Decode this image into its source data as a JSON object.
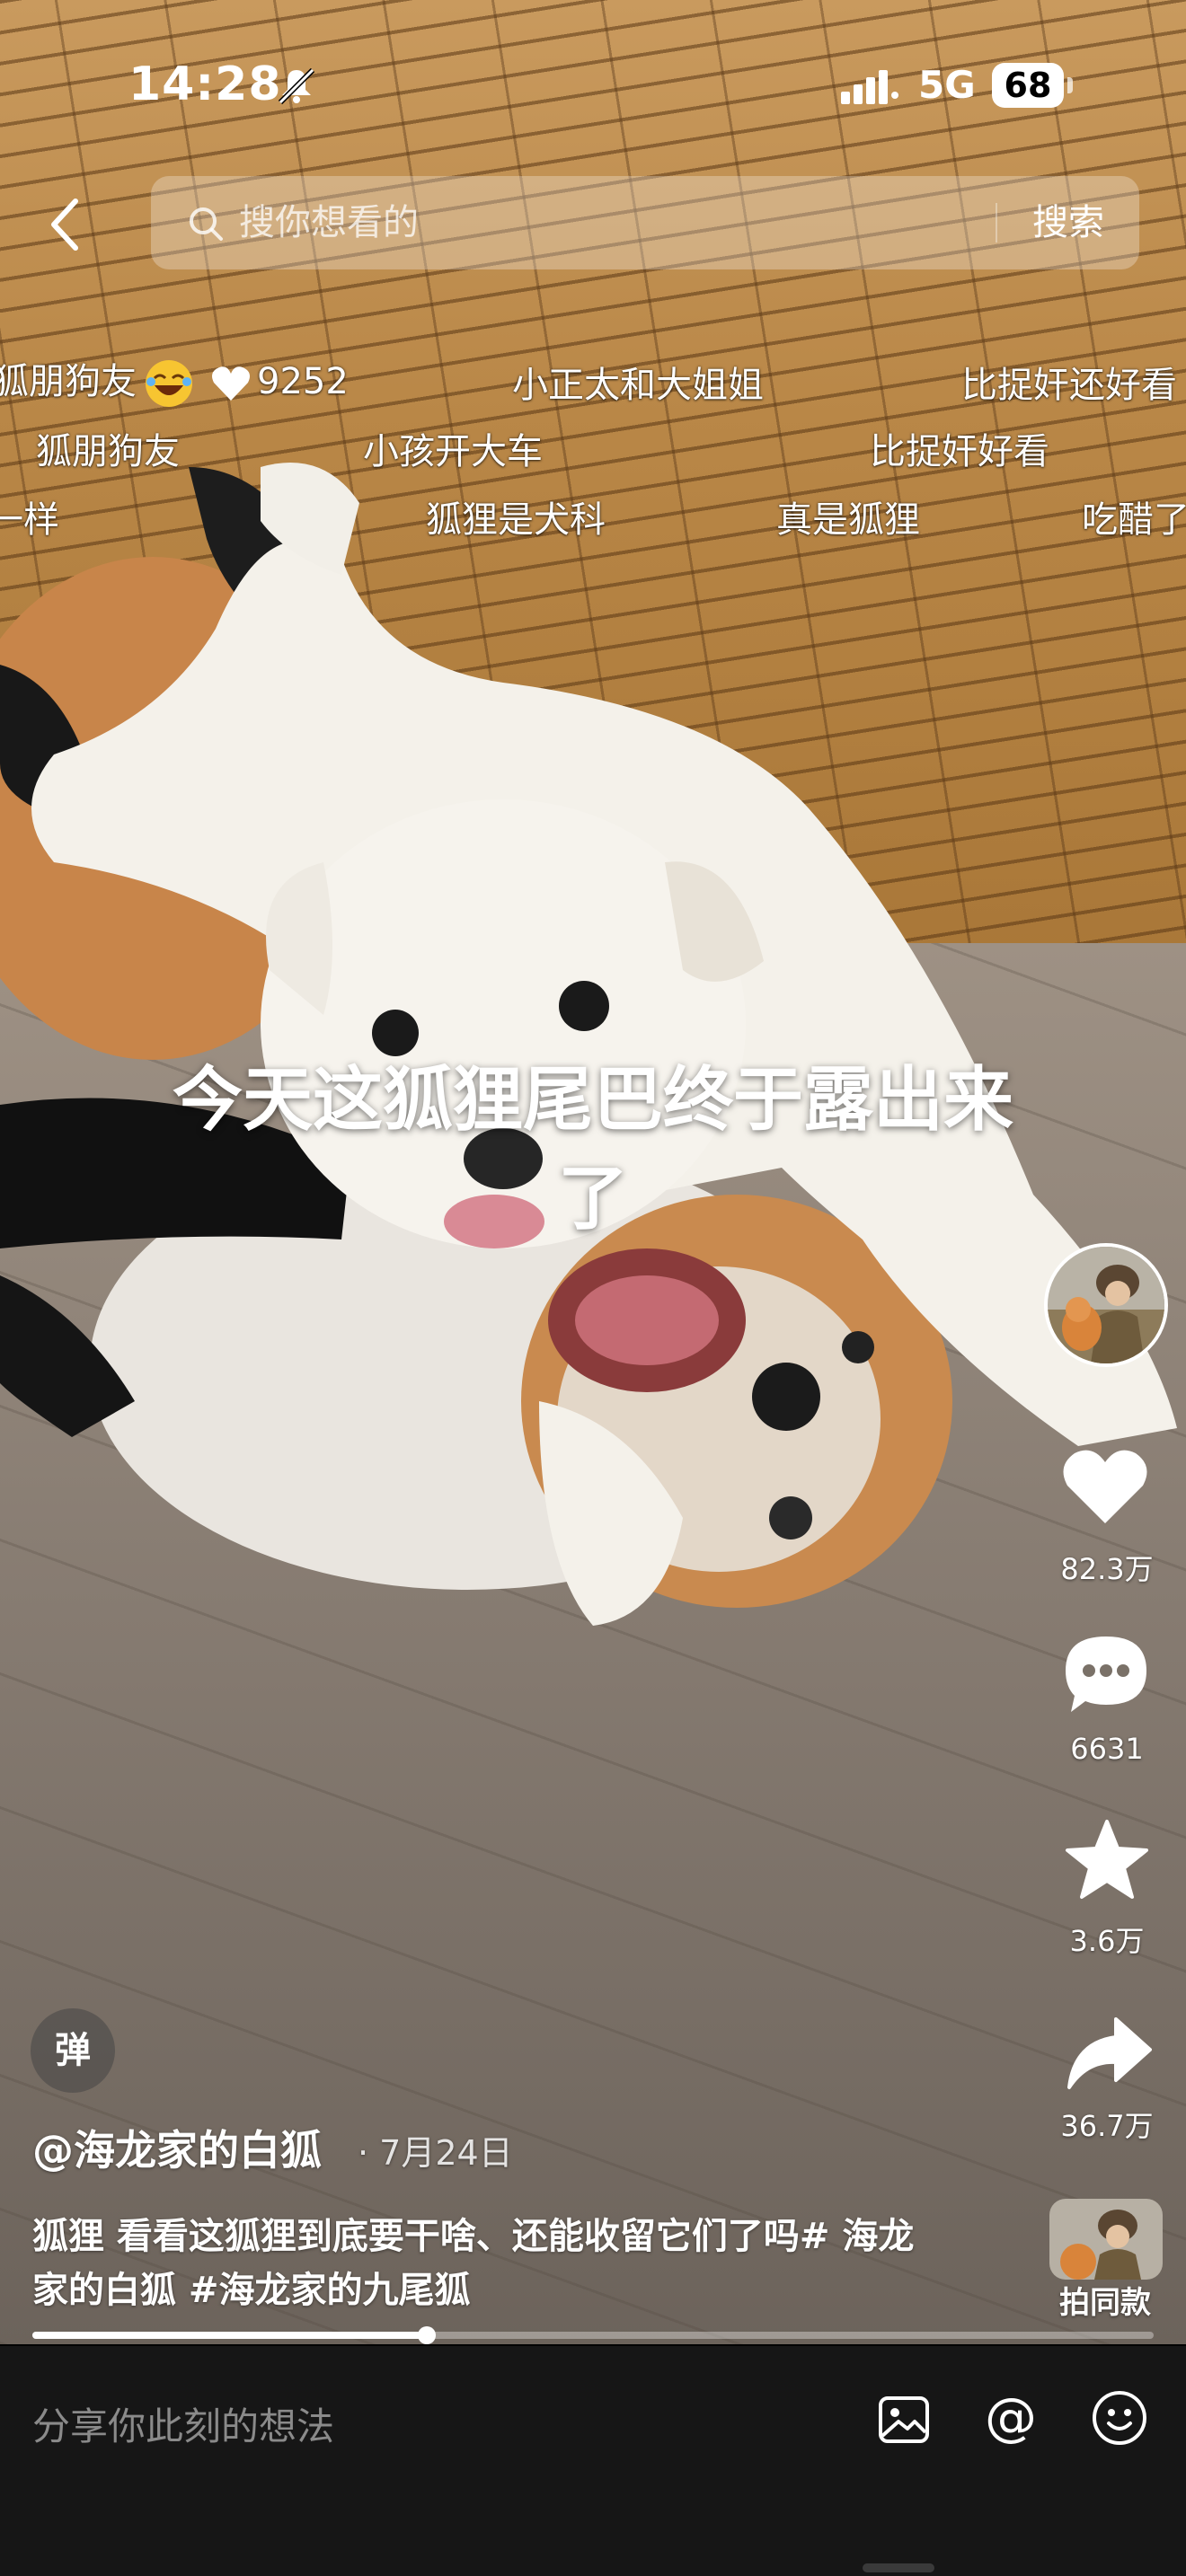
{
  "status_bar": {
    "time": "14:28",
    "network": "5G",
    "battery": "68"
  },
  "search": {
    "placeholder": "搜你想看的",
    "button_label": "搜索"
  },
  "danmaku": {
    "row1": [
      "狐朋狗友",
      "9252",
      "小正太和大姐姐",
      "比捉奸还好看"
    ],
    "row2": [
      "狐朋狗友",
      "小孩开大车",
      "比捉奸好看"
    ],
    "row3": [
      "一样",
      "狐狸是犬科",
      "真是狐狸",
      "吃醋了"
    ]
  },
  "caption": "今天这狐狸尾巴终于露出来了",
  "actions": {
    "likes": "82.3万",
    "comments": "6631",
    "favorites": "3.6万",
    "shares": "36.7万",
    "same_style": "拍同款"
  },
  "danmaku_toggle_label": "弹",
  "video_info": {
    "author": "@海龙家的白狐",
    "date": "· 7月24日",
    "description": "狐狸 看看这狐狸到底要干啥、还能收留它们了吗# 海龙家的白狐 #海龙家的九尾狐"
  },
  "progress": {
    "fraction": 0.352
  },
  "comment_bar": {
    "placeholder": "分享你此刻的想法",
    "mention_symbol": "@"
  },
  "colors": {
    "bar_background": "#161616",
    "text_primary": "#ffffff",
    "placeholder_gray": "#8a8a8a"
  }
}
